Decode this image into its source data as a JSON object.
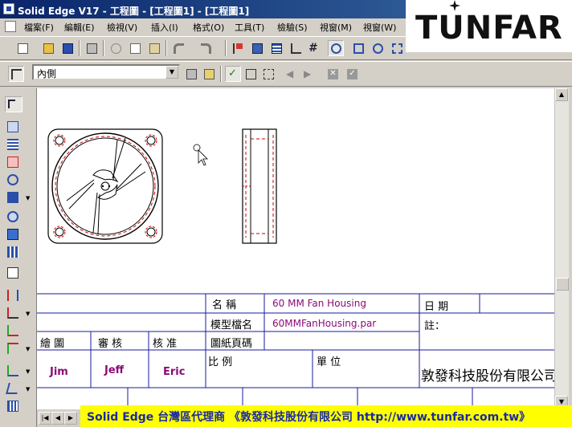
{
  "window": {
    "title": "Solid Edge V17 - 工程圖 - [工程圖1] - [工程圖1]"
  },
  "logo": {
    "text": "TUNFAR"
  },
  "menu": [
    "檔案(F)",
    "編輯(E)",
    "檢視(V)",
    "插入(I)",
    "格式(O)",
    "工具(T)",
    "檢驗(S)",
    "視窗(M)",
    "視窗(W)"
  ],
  "view_selector": {
    "value": "內側"
  },
  "title_block": {
    "name_label": "名 稱",
    "name_value": "60 MM Fan Housing",
    "date_label": "日 期",
    "model_file_label": "模型檔名",
    "model_file_value": "60MMFanHousing.par",
    "note_label": "註：",
    "sheet_no_label": "圖紙頁碼",
    "drawn_label": "繪 圖",
    "checked_label": "審 核",
    "approved_label": "核 准",
    "scale_label": "比 例",
    "unit_label": "單 位",
    "drawn_by": "Jim",
    "checked_by": "Jeff",
    "approved_by": "Eric",
    "company": "敦發科技股份有限公司"
  },
  "banner": {
    "text": "Solid Edge 台灣區代理商 《敦發科技股份有限公司 http://www.tunfar.com.tw》"
  },
  "colors": {
    "title_active": "#0a246a",
    "title_fade": "#3a6ea5",
    "drawing_line": "#000000",
    "hidden_line": "#cc0000",
    "title_block_line": "#1a1aa0",
    "value_text": "#8b0b75",
    "banner_bg": "#ffff00",
    "banner_text": "#1a2aa0"
  }
}
